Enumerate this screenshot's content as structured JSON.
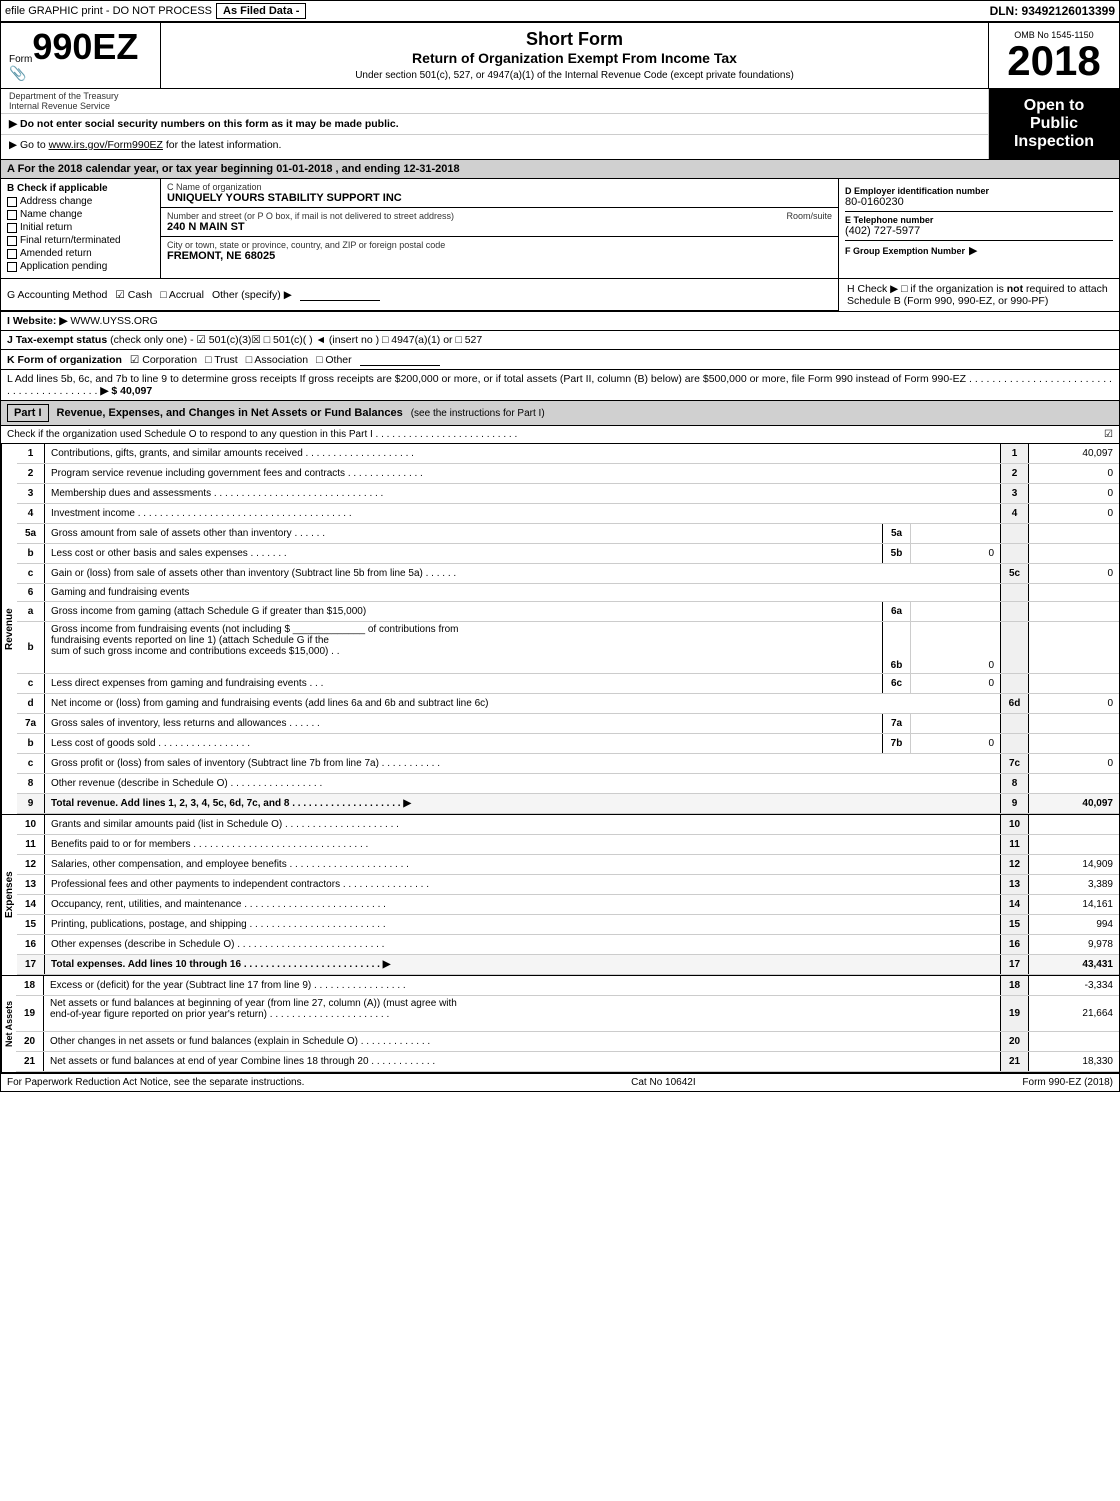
{
  "topBar": {
    "left": "efile GRAPHIC print - DO NOT PROCESS",
    "badge": "As Filed Data -",
    "dln": "DLN: 93492126013399"
  },
  "header": {
    "formLabel": "Form",
    "formNumber": "990EZ",
    "icon": "📎",
    "title": "Short Form",
    "subtitle": "Return of Organization Exempt From Income Tax",
    "undersection": "Under section 501(c), 527, or 4947(a)(1) of the Internal Revenue Code (except private foundations)",
    "omb": "OMB No 1545-1150",
    "year": "2018"
  },
  "instructions": {
    "item1": "▶ Do not enter social security numbers on this form as it may be made public.",
    "item2": "▶ Go to www.irs.gov/Form990EZ for the latest information.",
    "openLabel": "Open to",
    "publicLabel": "Public",
    "inspectionLabel": "Inspection"
  },
  "dept": "Department of the Treasury Internal Revenue Service",
  "sectionA": {
    "text": "A For the 2018 calendar year, or tax year beginning 01-01-2018 , and ending 12-31-2018"
  },
  "sectionB": {
    "label": "B Check if applicable",
    "checkboxes": [
      {
        "id": "address",
        "label": "Address change",
        "checked": false
      },
      {
        "id": "name",
        "label": "Name change",
        "checked": false
      },
      {
        "id": "initial",
        "label": "Initial return",
        "checked": false
      },
      {
        "id": "final",
        "label": "Final return/terminated",
        "checked": false
      },
      {
        "id": "amended",
        "label": "Amended return",
        "checked": false
      },
      {
        "id": "application",
        "label": "Application pending",
        "checked": false
      }
    ]
  },
  "sectionC": {
    "label": "C Name of organization",
    "orgName": "UNIQUELY YOURS STABILITY SUPPORT INC",
    "streetLabel": "Number and street (or P O box, if mail is not delivered to street address)",
    "roomLabel": "Room/suite",
    "street": "240 N MAIN ST",
    "cityLabel": "City or town, state or province, country, and ZIP or foreign postal code",
    "city": "FREMONT, NE 68025"
  },
  "sectionD": {
    "label": "D Employer identification number",
    "ein": "80-0160230"
  },
  "sectionE": {
    "label": "E Telephone number",
    "phone": "(402) 727-5977"
  },
  "sectionF": {
    "label": "F Group Exemption Number",
    "arrow": "▶"
  },
  "sectionG": {
    "label": "G Accounting Method",
    "cashChecked": true,
    "accrualChecked": false,
    "otherLabel": "Other (specify) ▶",
    "underline": ""
  },
  "sectionH": {
    "label": "H Check ▶",
    "checkboxText": "□ if the organization is not required to attach Schedule B (Form 990, 990-EZ, or 990-PF)"
  },
  "sectionI": {
    "label": "I Website: ▶",
    "website": "WWW.UYSS.ORG"
  },
  "sectionJ": {
    "label": "J Tax-exempt status",
    "text": "(check only one) - ☑ 501(c)(3)☒ □ 501(c)(  ) ◄ (insert no ) □ 4947(a)(1) or □ 527"
  },
  "sectionK": {
    "label": "K Form of organization",
    "corpChecked": true,
    "trustChecked": false,
    "assocChecked": false,
    "otherChecked": false
  },
  "sectionL": {
    "text": "L Add lines 5b, 6c, and 7b to line 9 to determine gross receipts If gross receipts are $200,000 or more, or if total assets (Part II, column (B) below) are $500,000 or more, file Form 990 instead of Form 990-EZ",
    "dots": "· · · · · · · · · · · · · · · · · · · · · · · · · · · · · · · · · · · · · · · ·",
    "value": "▶ $ 40,097"
  },
  "partI": {
    "label": "Part I",
    "title": "Revenue, Expenses, and Changes in Net Assets or Fund Balances",
    "subtitle": "(see the instructions for Part I)",
    "checkText": "Check if the organization used Schedule O to respond to any question in this Part I . . . . . . . . . . . . . . . . . . . . . . . . . .",
    "checkValue": "☑",
    "rows": [
      {
        "num": "1",
        "desc": "Contributions, gifts, grants, and similar amounts received . . . . . . . . . . . . . . . . . . . .",
        "lineNum": "1",
        "value": "40,097"
      },
      {
        "num": "2",
        "desc": "Program service revenue including government fees and contracts . . . . . . . . . . . . . .",
        "lineNum": "2",
        "value": "0"
      },
      {
        "num": "3",
        "desc": "Membership dues and assessments . . . . . . . . . . . . . . . . . . . . . . . . . . . . . . .",
        "lineNum": "3",
        "value": "0"
      },
      {
        "num": "4",
        "desc": "Investment income . . . . . . . . . . . . . . . . . . . . . . . . . . . . . . . . . . . . . . .",
        "lineNum": "4",
        "value": "0"
      }
    ],
    "row5a": {
      "desc": "Gross amount from sale of assets other than inventory . . . . . .",
      "lineLabel": "5a",
      "value": ""
    },
    "row5b": {
      "desc": "Less cost or other basis and sales expenses . . . . . . .",
      "lineLabel": "5b",
      "value": "0"
    },
    "row5c": {
      "num": "c",
      "desc": "Gain or (loss) from sale of assets other than inventory (Subtract line 5b from line 5a) . . . . . .",
      "lineNum": "5c",
      "value": "0"
    },
    "row6": {
      "desc": "Gaming and fundraising events"
    },
    "row6a": {
      "desc": "Gross income from gaming (attach Schedule G if greater than $15,000)",
      "lineLabel": "6a",
      "value": ""
    },
    "row6b": {
      "desc": "Gross income from fundraising events (not including $ _______ of contributions from fundraising events reported on line 1) (attach Schedule G if the sum of such gross income and contributions exceeds $15,000) . .",
      "lineLabel": "6b",
      "value": "0"
    },
    "row6c": {
      "desc": "Less direct expenses from gaming and fundraising events . . .",
      "lineLabel": "6c",
      "value": "0"
    },
    "row6d": {
      "num": "d",
      "desc": "Net income or (loss) from gaming and fundraising events (add lines 6a and 6b and subtract line 6c)",
      "lineNum": "6d",
      "value": "0"
    },
    "row7a": {
      "desc": "Gross sales of inventory, less returns and allowances . . . . . .",
      "lineLabel": "7a",
      "value": ""
    },
    "row7b": {
      "desc": "Less cost of goods sold . . . . . . . . . . . . . . . . .",
      "lineLabel": "7b",
      "value": "0"
    },
    "row7c": {
      "num": "c",
      "desc": "Gross profit or (loss) from sales of inventory (Subtract line 7b from line 7a) . . . . . . . . . . .",
      "lineNum": "7c",
      "value": "0"
    },
    "row8": {
      "num": "8",
      "desc": "Other revenue (describe in Schedule O) . . . . . . . . . . . . . . . . .",
      "lineNum": "8",
      "value": ""
    },
    "row9": {
      "num": "9",
      "desc": "Total revenue. Add lines 1, 2, 3, 4, 5c, 6d, 7c, and 8 . . . . . . . . . . . . . . . . . . . . ▶",
      "lineNum": "9",
      "value": "40,097",
      "bold": true
    },
    "expRows": [
      {
        "num": "10",
        "desc": "Grants and similar amounts paid (list in Schedule O) . . . . . . . . . . . . . . . . . . . . .",
        "lineNum": "10",
        "value": ""
      },
      {
        "num": "11",
        "desc": "Benefits paid to or for members . . . . . . . . . . . . . . . . . . . . . . . . . . . . . . . .",
        "lineNum": "11",
        "value": ""
      },
      {
        "num": "12",
        "desc": "Salaries, other compensation, and employee benefits . . . . . . . . . . . . . . . . . . . . . .",
        "lineNum": "12",
        "value": "14,909"
      },
      {
        "num": "13",
        "desc": "Professional fees and other payments to independent contractors . . . . . . . . . . . . . . . .",
        "lineNum": "13",
        "value": "3,389"
      },
      {
        "num": "14",
        "desc": "Occupancy, rent, utilities, and maintenance . . . . . . . . . . . . . . . . . . . . . . . . . .",
        "lineNum": "14",
        "value": "14,161"
      },
      {
        "num": "15",
        "desc": "Printing, publications, postage, and shipping . . . . . . . . . . . . . . . . . . . . . . . . .",
        "lineNum": "15",
        "value": "994"
      },
      {
        "num": "16",
        "desc": "Other expenses (describe in Schedule O) . . . . . . . . . . . . . . . . . . . . . . . . . . .",
        "lineNum": "16",
        "value": "9,978"
      },
      {
        "num": "17",
        "desc": "Total expenses. Add lines 10 through 16 . . . . . . . . . . . . . . . . . . . . . . . . . ▶",
        "lineNum": "17",
        "value": "43,431",
        "bold": true
      }
    ],
    "netRows": [
      {
        "num": "18",
        "desc": "Excess or (deficit) for the year (Subtract line 17 from line 9) . . . . . . . . . . . . . . . . .",
        "lineNum": "18",
        "value": "-3,334"
      },
      {
        "num": "19",
        "desc": "Net assets or fund balances at beginning of year (from line 27, column (A)) (must agree with end-of-year figure reported on prior year's return) . . . . . . . . . . . . . . . . . . . . . .",
        "lineNum": "19",
        "value": "21,664"
      },
      {
        "num": "20",
        "desc": "Other changes in net assets or fund balances (explain in Schedule O) . . . . . . . . . . . . .",
        "lineNum": "20",
        "value": ""
      },
      {
        "num": "21",
        "desc": "Net assets or fund balances at end of year Combine lines 18 through 20 . . . . . . . . . . . .",
        "lineNum": "21",
        "value": "18,330"
      }
    ]
  },
  "footer": {
    "paperwork": "For Paperwork Reduction Act Notice, see the separate instructions.",
    "catNo": "Cat No 10642I",
    "formRef": "Form 990-EZ (2018)"
  }
}
